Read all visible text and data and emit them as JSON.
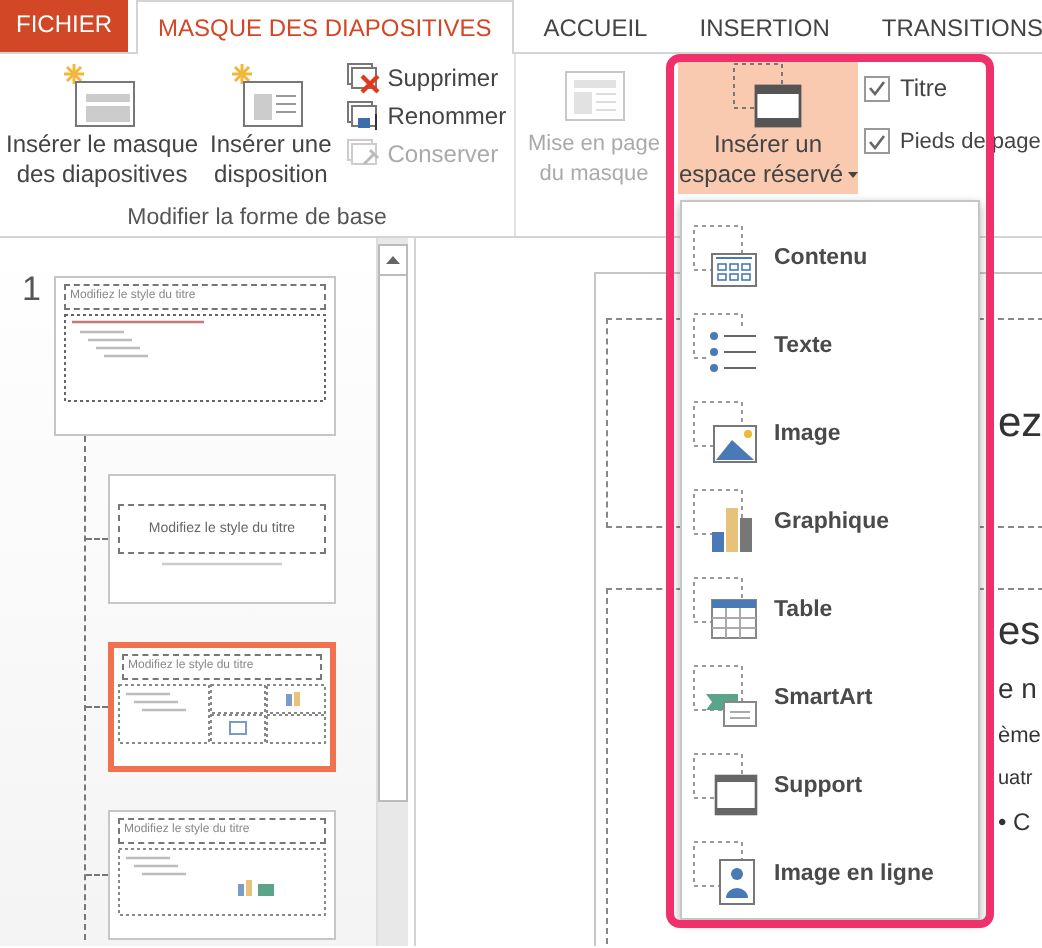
{
  "tabs": [
    {
      "label": "FICHIER",
      "kind": "file",
      "selected": false
    },
    {
      "label": "MASQUE DES DIAPOSITIVES",
      "kind": "tab",
      "selected": true
    },
    {
      "label": "ACCUEIL",
      "kind": "tab",
      "selected": false
    },
    {
      "label": "INSERTION",
      "kind": "tab",
      "selected": false
    },
    {
      "label": "TRANSITIONS",
      "kind": "tab",
      "selected": false
    }
  ],
  "ribbon": {
    "master_group": {
      "label": "Modifier la forme de base",
      "large_buttons": [
        {
          "lines": [
            "Insérer le masque",
            "des diapositives"
          ],
          "kind": "insert-master"
        },
        {
          "lines": [
            "Insérer une",
            "disposition"
          ],
          "kind": "insert-layout"
        }
      ],
      "small_buttons": [
        {
          "label": "Supprimer",
          "kind": "delete",
          "disabled": false
        },
        {
          "label": "Renommer",
          "kind": "rename",
          "disabled": false
        },
        {
          "label": "Conserver",
          "kind": "preserve",
          "disabled": true
        }
      ]
    },
    "layout_group": {
      "large_buttons": [
        {
          "lines": [
            "Mise en page",
            "du masque"
          ],
          "kind": "master-layout",
          "disabled": true,
          "expanded": false
        },
        {
          "lines": [
            "Insérer un",
            "espace réservé"
          ],
          "kind": "placeholder",
          "disabled": false,
          "expanded": true
        }
      ],
      "checkboxes": [
        {
          "label": "Titre",
          "checked": true
        },
        {
          "label": "Pieds de page",
          "checked": true
        }
      ]
    }
  },
  "slide_panel": {
    "slides": [
      {
        "number": "1",
        "kind": "master",
        "title": "Modifiez le style du titre",
        "selected": false,
        "children": [
          {
            "kind": "title-slide",
            "title": "Modifiez le style du titre",
            "selected": false
          },
          {
            "kind": "multi-content",
            "title": "Modifiez le style du titre",
            "selected": true
          },
          {
            "kind": "content",
            "title": "Modifiez le style du titre",
            "selected": false
          }
        ]
      }
    ]
  },
  "slide_editor": {
    "lines": [
      {
        "text": "ez",
        "kind": "title"
      },
      {
        "text": "es",
        "kind": "level-1"
      },
      {
        "text": "e n",
        "kind": "level-2"
      },
      {
        "text": "ème",
        "kind": "level-3"
      },
      {
        "text": "uatr",
        "kind": "level-4"
      },
      {
        "text": "• C",
        "kind": "level-5"
      }
    ]
  },
  "placeholder_menu": {
    "items": [
      {
        "label": "Contenu",
        "kind": "content"
      },
      {
        "label": "Texte",
        "kind": "text"
      },
      {
        "label": "Image",
        "kind": "picture"
      },
      {
        "label": "Graphique",
        "kind": "chart"
      },
      {
        "label": "Table",
        "kind": "table"
      },
      {
        "label": "SmartArt",
        "kind": "smartart"
      },
      {
        "label": "Support",
        "kind": "media"
      },
      {
        "label": "Image en ligne",
        "kind": "online-picture"
      }
    ]
  }
}
